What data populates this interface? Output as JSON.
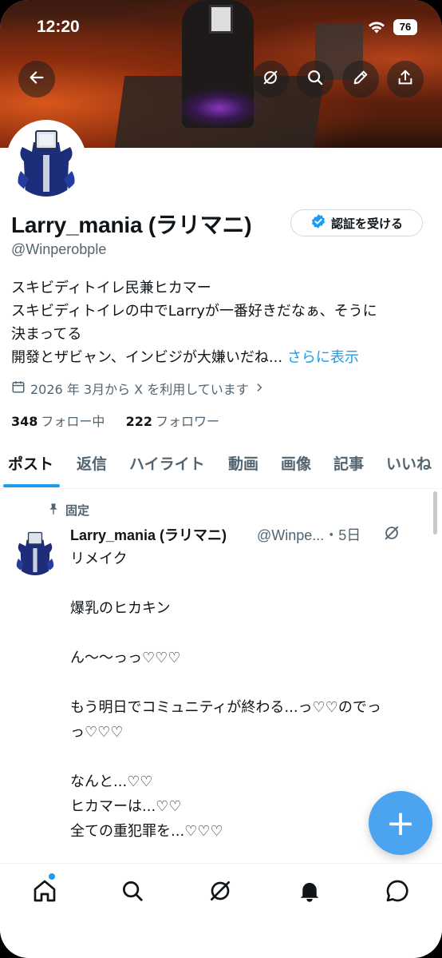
{
  "status_bar": {
    "time": "12:20",
    "battery": "76"
  },
  "profile": {
    "display_name": "Larry_mania (ラリマニ)",
    "handle": "@Winperobple",
    "verify_label": "認証を受ける",
    "bio_lines": [
      "スキビディトイレ民兼ヒカマー",
      "スキビディトイレの中でLarryが一番好きだなぁ、そうに",
      "決まってる",
      "開發とザビャン、インビジが大嫌いだね..."
    ],
    "bio_more": "さらに表示",
    "joined": "2026 年 3月から X を利用しています",
    "following_count": "348",
    "following_label": "フォロー中",
    "followers_count": "222",
    "followers_label": "フォロワー"
  },
  "tabs": [
    "ポスト",
    "返信",
    "ハイライト",
    "動画",
    "画像",
    "記事",
    "いいね"
  ],
  "pinned_post": {
    "pinned_label": "固定",
    "author": "Larry_mania (ラリマニ)",
    "handle_time": "@Winpe...・5日",
    "body": "リメイク\n\n爆乳のヒカキン\n\nん〜〜っっ♡♡♡\n\nもう明日でコミュニティが終わる...っ♡♡のでっ\nっ♡♡♡\n\nなんと...♡♡\nヒカマーは...♡♡\n全ての重犯罪を...♡♡♡\n\n解禁〜〜〜〜〜〜〜〜っっっ♡♡♡♡♡♡♡"
  },
  "fab_label": "+",
  "icons": {
    "back": "arrow-left-icon",
    "grok": "grok-icon",
    "search": "search-icon",
    "edit": "pencil-icon",
    "share": "share-icon",
    "calendar": "calendar-icon",
    "pin": "pin-icon",
    "home": "home-icon",
    "bell": "bell-icon",
    "messages": "messages-icon"
  },
  "colors": {
    "accent": "#1d9bf0",
    "fab": "#4ca3f0",
    "text": "#0f1419",
    "muted": "#536471"
  }
}
